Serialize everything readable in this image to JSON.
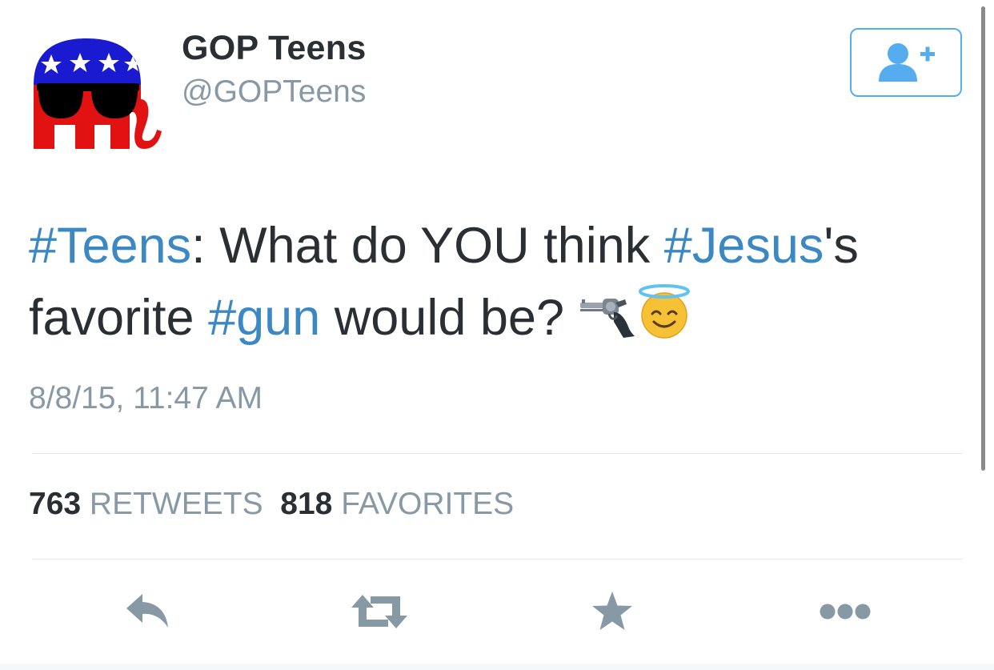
{
  "user": {
    "display_name": "GOP Teens",
    "handle": "@GOPTeens",
    "avatar_icon": "republican-elephant-with-sunglasses-icon"
  },
  "follow_button": {
    "icon": "add-user-icon"
  },
  "tweet": {
    "segments": [
      {
        "text": "#Teens",
        "type": "hashtag"
      },
      {
        "text": ": What do YOU think ",
        "type": "text"
      },
      {
        "text": "#Jesus",
        "type": "hashtag"
      },
      {
        "text": "'s favorite ",
        "type": "text"
      },
      {
        "text": "#gun",
        "type": "hashtag"
      },
      {
        "text": " would be? ",
        "type": "text"
      }
    ],
    "emojis": [
      "pistol-emoji",
      "smiling-face-with-halo-emoji"
    ],
    "timestamp": "8/8/15, 11:47 AM"
  },
  "stats": {
    "retweets_count": "763",
    "retweets_label": "RETWEETS",
    "favorites_count": "818",
    "favorites_label": "FAVORITES"
  },
  "actions": [
    "reply-icon",
    "retweet-icon",
    "favorite-star-icon",
    "more-icon"
  ],
  "colors": {
    "hashtag": "#3b88c3",
    "secondary_text": "#8899a6",
    "primary_text": "#292f33",
    "accent": "#55acee",
    "action_icon": "#8899a6",
    "divider": "#e1e8ed"
  }
}
